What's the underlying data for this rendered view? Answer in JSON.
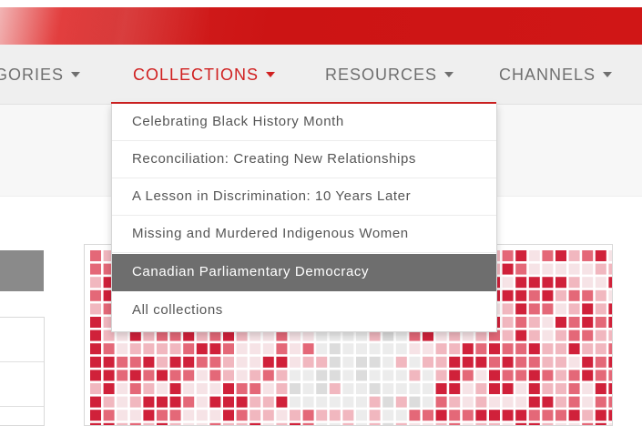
{
  "colors": {
    "brand_red": "#d02020",
    "nav_text": "#6f6f6f",
    "highlight_bg": "#6e6e6e",
    "mosaic_dark_red": "#d0213a",
    "mosaic_mid_red": "#e46878",
    "mosaic_light_red": "#f1b7bf",
    "mosaic_pale": "#f6e3e6"
  },
  "nav": {
    "items": [
      {
        "label": "GORIES",
        "icon": "chevron-down-icon",
        "active": false
      },
      {
        "label": "COLLECTIONS",
        "icon": "chevron-down-icon",
        "active": true
      },
      {
        "label": "RESOURCES",
        "icon": "chevron-down-icon",
        "active": false
      },
      {
        "label": "CHANNELS",
        "icon": "chevron-down-icon",
        "active": false
      }
    ]
  },
  "collections_menu": {
    "items": [
      "Celebrating Black History Month",
      "Reconciliation: Creating New Relationships",
      "A Lesson in Discrimination: 10 Years Later",
      "Missing and Murdered Indigenous Women",
      "Canadian Parliamentary Democracy",
      "All collections"
    ],
    "highlighted_index": 4
  },
  "featured_image": {
    "description_icon": "maple-leaf-mosaic-icon"
  }
}
